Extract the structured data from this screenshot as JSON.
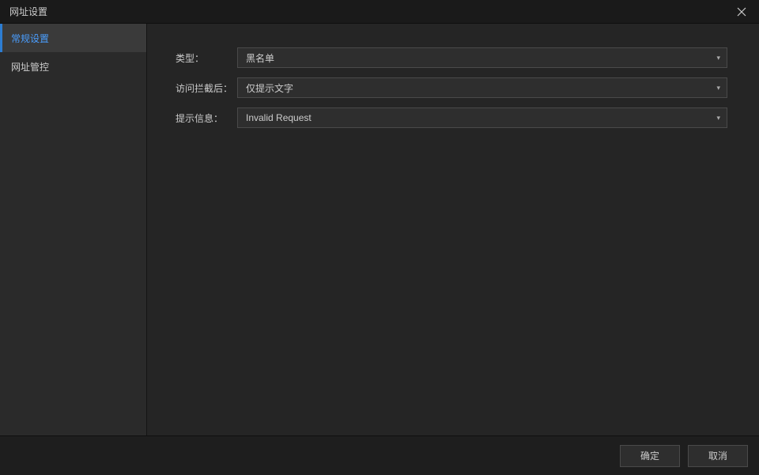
{
  "titlebar": {
    "title": "网址设置"
  },
  "sidebar": {
    "items": [
      {
        "label": "常规设置",
        "active": true
      },
      {
        "label": "网址管控",
        "active": false
      }
    ]
  },
  "form": {
    "type": {
      "label": "类型：",
      "value": "黑名单"
    },
    "after_block": {
      "label": "访问拦截后：",
      "value": "仅提示文字"
    },
    "hint": {
      "label": "提示信息：",
      "value": "Invalid Request"
    }
  },
  "footer": {
    "ok": "确定",
    "cancel": "取消"
  }
}
